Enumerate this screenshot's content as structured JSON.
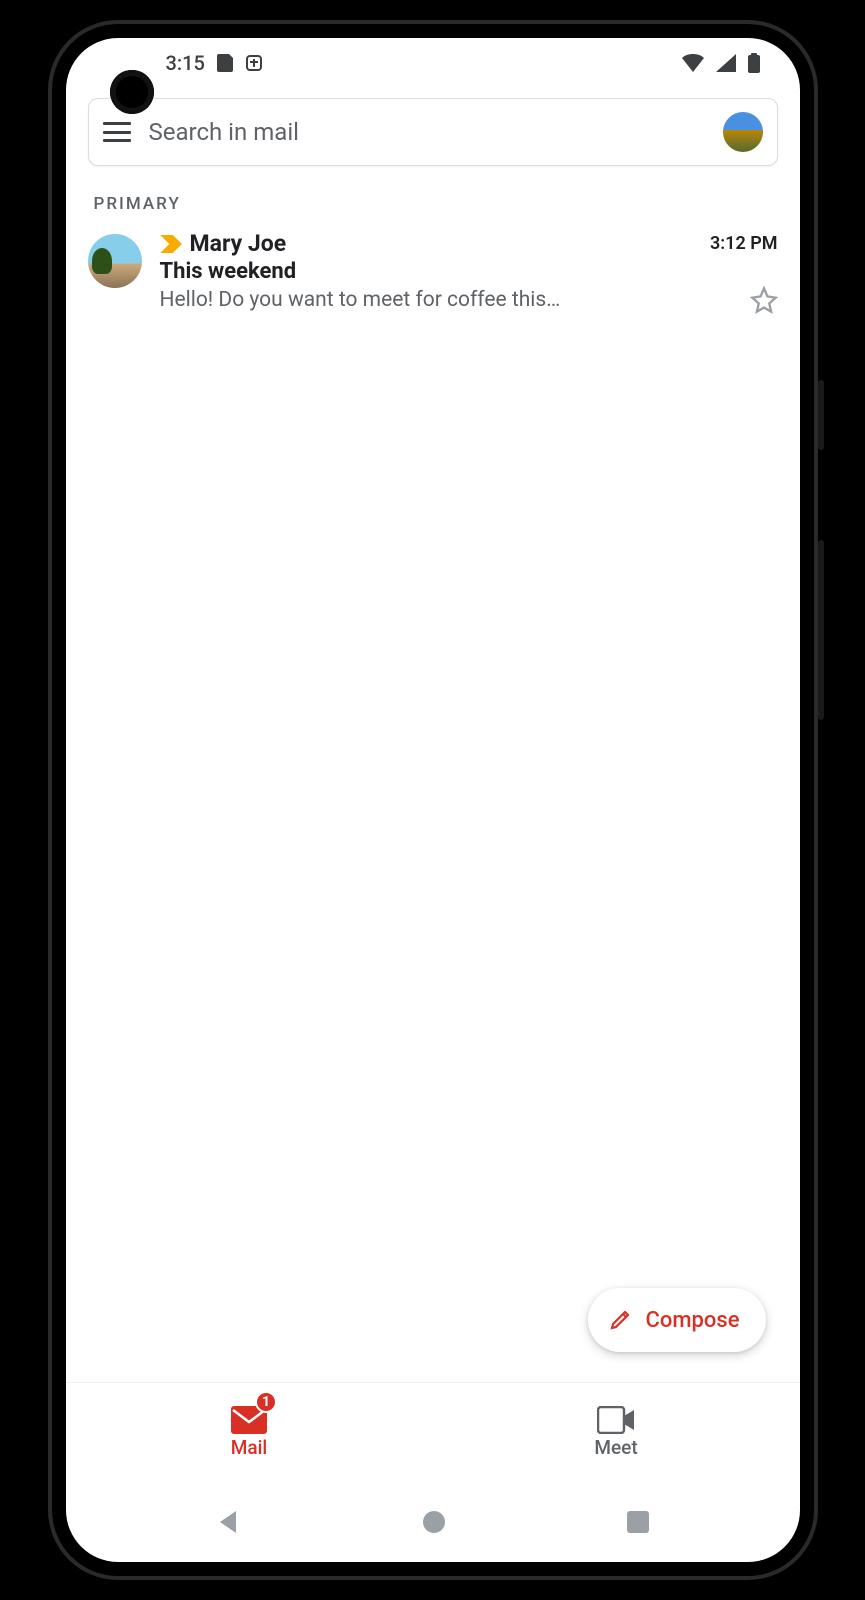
{
  "status": {
    "time": "3:15"
  },
  "search": {
    "placeholder": "Search in mail"
  },
  "sections": {
    "primary": "PRIMARY"
  },
  "emails": [
    {
      "sender": "Mary Joe",
      "time": "3:12 PM",
      "subject": "This weekend",
      "snippet": "Hello! Do you want to meet for coffee this…"
    }
  ],
  "compose": {
    "label": "Compose"
  },
  "nav": {
    "mail": {
      "label": "Mail",
      "badge": "1"
    },
    "meet": {
      "label": "Meet"
    }
  },
  "colors": {
    "accent": "#d93025",
    "important": "#f9ab00"
  }
}
